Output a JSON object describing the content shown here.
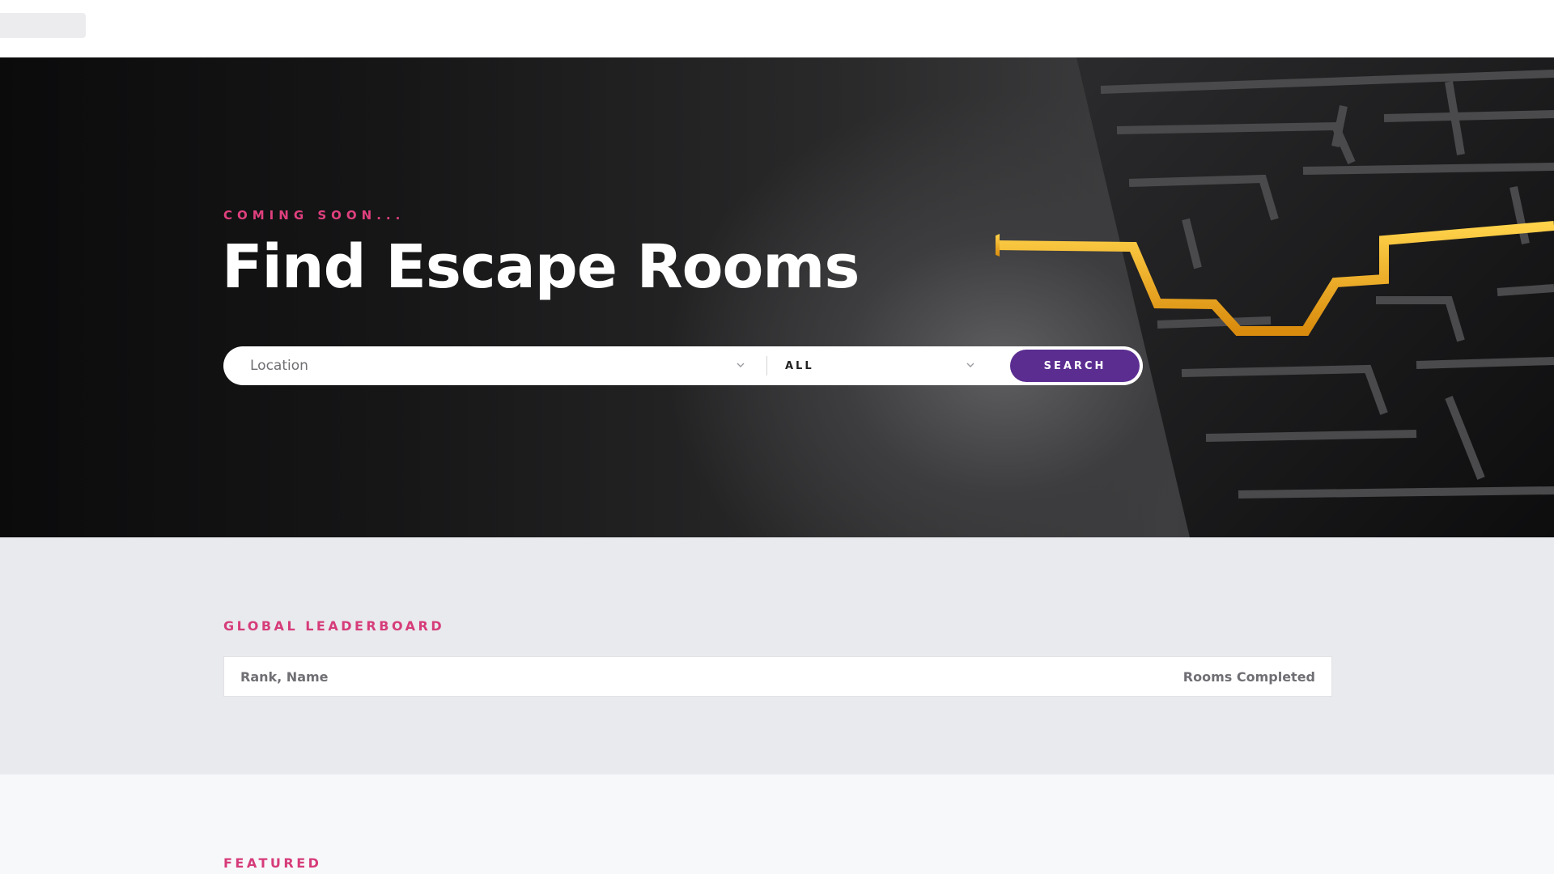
{
  "colors": {
    "accent_pink": "#e0407e",
    "button_purple": "#5b2d91",
    "maze_highlight": "#f2b21c"
  },
  "hero": {
    "eyebrow": "COMING SOON...",
    "title": "Find Escape Rooms",
    "background_image": "dark maze with golden arrow path"
  },
  "search": {
    "location_placeholder": "Location",
    "type_value": "ALL",
    "button_label": "SEARCH",
    "chevron_icon": "chevron-down-icon"
  },
  "leaderboard": {
    "heading": "GLOBAL LEADERBOARD",
    "columns": [
      "Rank, Name",
      "Rooms Completed"
    ]
  },
  "featured": {
    "heading": "FEATURED"
  }
}
